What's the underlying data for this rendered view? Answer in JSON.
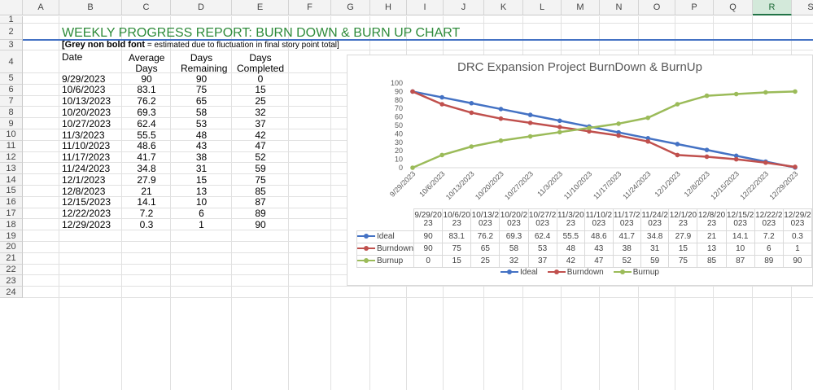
{
  "sheet": {
    "columns": [
      "A",
      "B",
      "C",
      "D",
      "E",
      "F",
      "G",
      "H",
      "I",
      "J",
      "K",
      "L",
      "M",
      "N",
      "O",
      "P",
      "Q",
      "R",
      "S"
    ],
    "selected_column": "R",
    "rows": [
      "1",
      "2",
      "3",
      "4",
      "5",
      "6",
      "7",
      "8",
      "9",
      "10",
      "11",
      "12",
      "13",
      "14",
      "15",
      "16",
      "17",
      "18",
      "19",
      "20",
      "21",
      "22",
      "23",
      "24"
    ],
    "title": "WEEKLY PROGRESS REPORT: BURN DOWN & BURN UP CHART",
    "note_bold": "[Grey non bold font",
    "note_rest": " = estimated due to fluctuation in final story point total]",
    "headers": [
      "Date",
      "Average Days",
      "Days Remaining",
      "Days Completed"
    ],
    "data": [
      [
        "9/29/2023",
        "90",
        "90",
        "0"
      ],
      [
        "10/6/2023",
        "83.1",
        "75",
        "15"
      ],
      [
        "10/13/2023",
        "76.2",
        "65",
        "25"
      ],
      [
        "10/20/2023",
        "69.3",
        "58",
        "32"
      ],
      [
        "10/27/2023",
        "62.4",
        "53",
        "37"
      ],
      [
        "11/3/2023",
        "55.5",
        "48",
        "42"
      ],
      [
        "11/10/2023",
        "48.6",
        "43",
        "47"
      ],
      [
        "11/17/2023",
        "41.7",
        "38",
        "52"
      ],
      [
        "11/24/2023",
        "34.8",
        "31",
        "59"
      ],
      [
        "12/1/2023",
        "27.9",
        "15",
        "75"
      ],
      [
        "12/8/2023",
        "21",
        "13",
        "85"
      ],
      [
        "12/15/2023",
        "14.1",
        "10",
        "87"
      ],
      [
        "12/22/2023",
        "7.2",
        "6",
        "89"
      ],
      [
        "12/29/2023",
        "0.3",
        "1",
        "90"
      ]
    ],
    "title_color": "#2e8b3a"
  },
  "chart_data": {
    "type": "line",
    "title": "DRC Expansion Project BurnDown & BurnUp",
    "categories": [
      "9/29/2023",
      "10/6/2023",
      "10/13/2023",
      "10/20/2023",
      "10/27/2023",
      "11/3/2023",
      "11/10/2023",
      "11/17/2023",
      "11/24/2023",
      "12/1/2023",
      "12/8/2023",
      "12/15/2023",
      "12/22/2023",
      "12/29/2023"
    ],
    "table_categories": [
      "9/29/20 23",
      "10/6/20 23",
      "10/13/2 023",
      "10/20/2 023",
      "10/27/2 023",
      "11/3/20 23",
      "11/10/2 023",
      "11/17/2 023",
      "11/24/2 023",
      "12/1/20 23",
      "12/8/20 23",
      "12/15/2 023",
      "12/22/2 023",
      "12/29/2 023"
    ],
    "series": [
      {
        "name": "Ideal",
        "color": "#4472c4",
        "values": [
          90,
          83.1,
          76.2,
          69.3,
          62.4,
          55.5,
          48.6,
          41.7,
          34.8,
          27.9,
          21,
          14.1,
          7.2,
          0.3
        ]
      },
      {
        "name": "Burndown",
        "color": "#c0504d",
        "values": [
          90,
          75,
          65,
          58,
          53,
          48,
          43,
          38,
          31,
          15,
          13,
          10,
          6,
          1
        ]
      },
      {
        "name": "Burnup",
        "color": "#9bbb59",
        "values": [
          0,
          15,
          25,
          32,
          37,
          42,
          47,
          52,
          59,
          75,
          85,
          87,
          89,
          90
        ]
      }
    ],
    "yticks": [
      "0",
      "10",
      "20",
      "30",
      "40",
      "50",
      "60",
      "70",
      "80",
      "90",
      "100"
    ],
    "ylim": [
      0,
      100
    ],
    "grid": false,
    "legend": "bottom"
  }
}
